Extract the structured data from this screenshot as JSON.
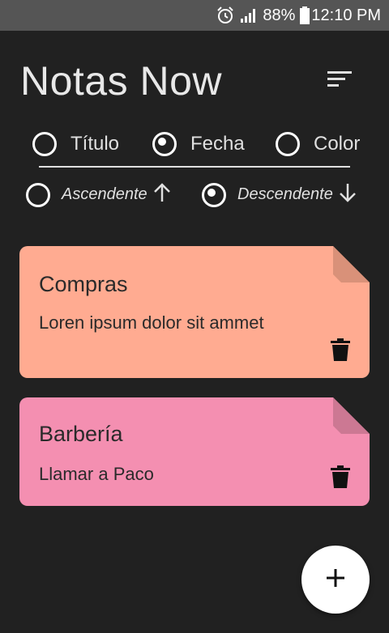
{
  "status_bar": {
    "battery": "88%",
    "time": "12:10 PM"
  },
  "header": {
    "title": "Notas Now",
    "sort_icon": "sort-icon"
  },
  "sort_by": {
    "options": [
      {
        "label": "Título",
        "checked": false
      },
      {
        "label": "Fecha",
        "checked": true
      },
      {
        "label": "Color",
        "checked": false
      }
    ]
  },
  "order": {
    "options": [
      {
        "label": "Ascendente",
        "icon": "arrow-up-icon",
        "checked": false
      },
      {
        "label": "Descendente",
        "icon": "arrow-down-icon",
        "checked": true
      }
    ]
  },
  "notes": [
    {
      "title": "Compras",
      "body": "Loren ipsum dolor sit ammet",
      "color": "#ffab91",
      "fold_color": "#d99179"
    },
    {
      "title": "Barbería",
      "body": "Llamar a Paco",
      "color": "#f48fb1",
      "fold_color": "#cc7893"
    }
  ],
  "fab": {
    "icon": "plus-icon"
  },
  "colors": {
    "background": "#212121",
    "status_bar": "#555555",
    "text": "#e0e0e0"
  }
}
